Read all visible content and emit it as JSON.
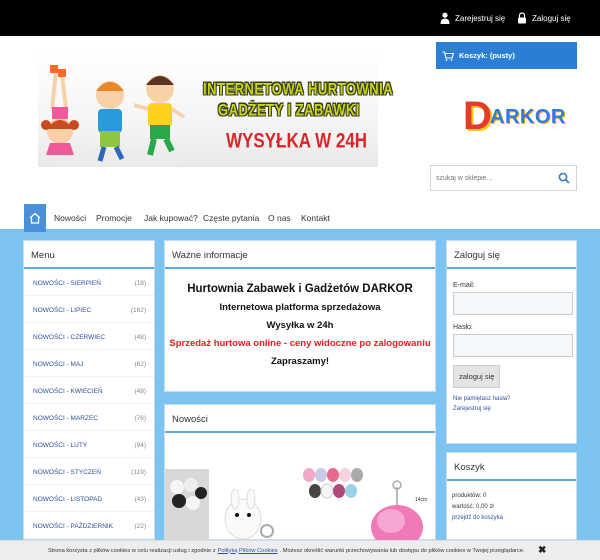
{
  "topbar": {
    "register_label": "Zarejestruj się",
    "login_label": "Zaloguj się"
  },
  "banner": {
    "line1": "INTERNETOWA HURTOWNIA",
    "line2": "GADŻETY I ZABAWKI",
    "line3": "WYSYŁKA W 24H"
  },
  "cart": {
    "label": "Koszyk: (pusty)"
  },
  "logo": {
    "first_letter": "D",
    "rest": "ARKOR"
  },
  "search": {
    "placeholder": "szukaj w sklepie..."
  },
  "nav": {
    "items": [
      "Nowości",
      "Promocje",
      "Jak kupować?",
      "Częste pytania",
      "O nas",
      "Kontakt"
    ]
  },
  "menu": {
    "title": "Menu",
    "items": [
      {
        "label": "NOWOŚCI - SIERPIEŃ",
        "count": "(18)"
      },
      {
        "label": "NOWOŚCI - LIPIEC",
        "count": "(162)"
      },
      {
        "label": "NOWOŚCI - CZERWIEC",
        "count": "(48)"
      },
      {
        "label": "NOWOŚCI - MAJ",
        "count": "(62)"
      },
      {
        "label": "NOWOŚCI - KWIECIEŃ",
        "count": "(49)"
      },
      {
        "label": "NOWOŚCI - MARZEC",
        "count": "(76)"
      },
      {
        "label": "NOWOŚCI - LUTY",
        "count": "(94)"
      },
      {
        "label": "NOWOŚCI - STYCZEŃ",
        "count": "(119)"
      },
      {
        "label": "NOWOŚCI - LISTOPAD",
        "count": "(43)"
      },
      {
        "label": "NOWOŚCI - PAŹDZIERNIK",
        "count": "(22)"
      }
    ]
  },
  "info": {
    "title": "Ważne informacje",
    "line1": "Hurtownia Zabawek i Gadżetów DARKOR",
    "line2": "Internetowa platforma sprzedażowa",
    "line3": "Wysyłka w 24h",
    "line4": "Sprzedaż hurtowa online - ceny widoczne po zalogowaniu",
    "line5": "Zapraszamy!",
    "highlight_color": "#e02020"
  },
  "news": {
    "title": "Nowości",
    "tag": "14cm"
  },
  "login": {
    "title": "Zaloguj się",
    "email_label": "E-mail:",
    "password_label": "Hasło:",
    "button_label": "zaloguj się",
    "forgot_label": "Nie pamiętasz hasła?",
    "register_label": "Zarejestruj się"
  },
  "cart_panel": {
    "title": "Koszyk",
    "products": "produktów: 0",
    "value": "wartość: 0,00 zł",
    "go_to_cart": "przejdź do koszyka"
  },
  "cookie": {
    "text_before": "Strona korzysta z plików cookies w celu realizacji usług i zgodnie z",
    "link": "Polityką Plików Cookies",
    "text_after": ". Możesz określić warunki przechowywania lub dostępu do plików cookies w Twojej przeglądarce.",
    "close": "✖"
  },
  "colors": {
    "accent": "#2a7fd4",
    "background": "#7ec4f0"
  }
}
